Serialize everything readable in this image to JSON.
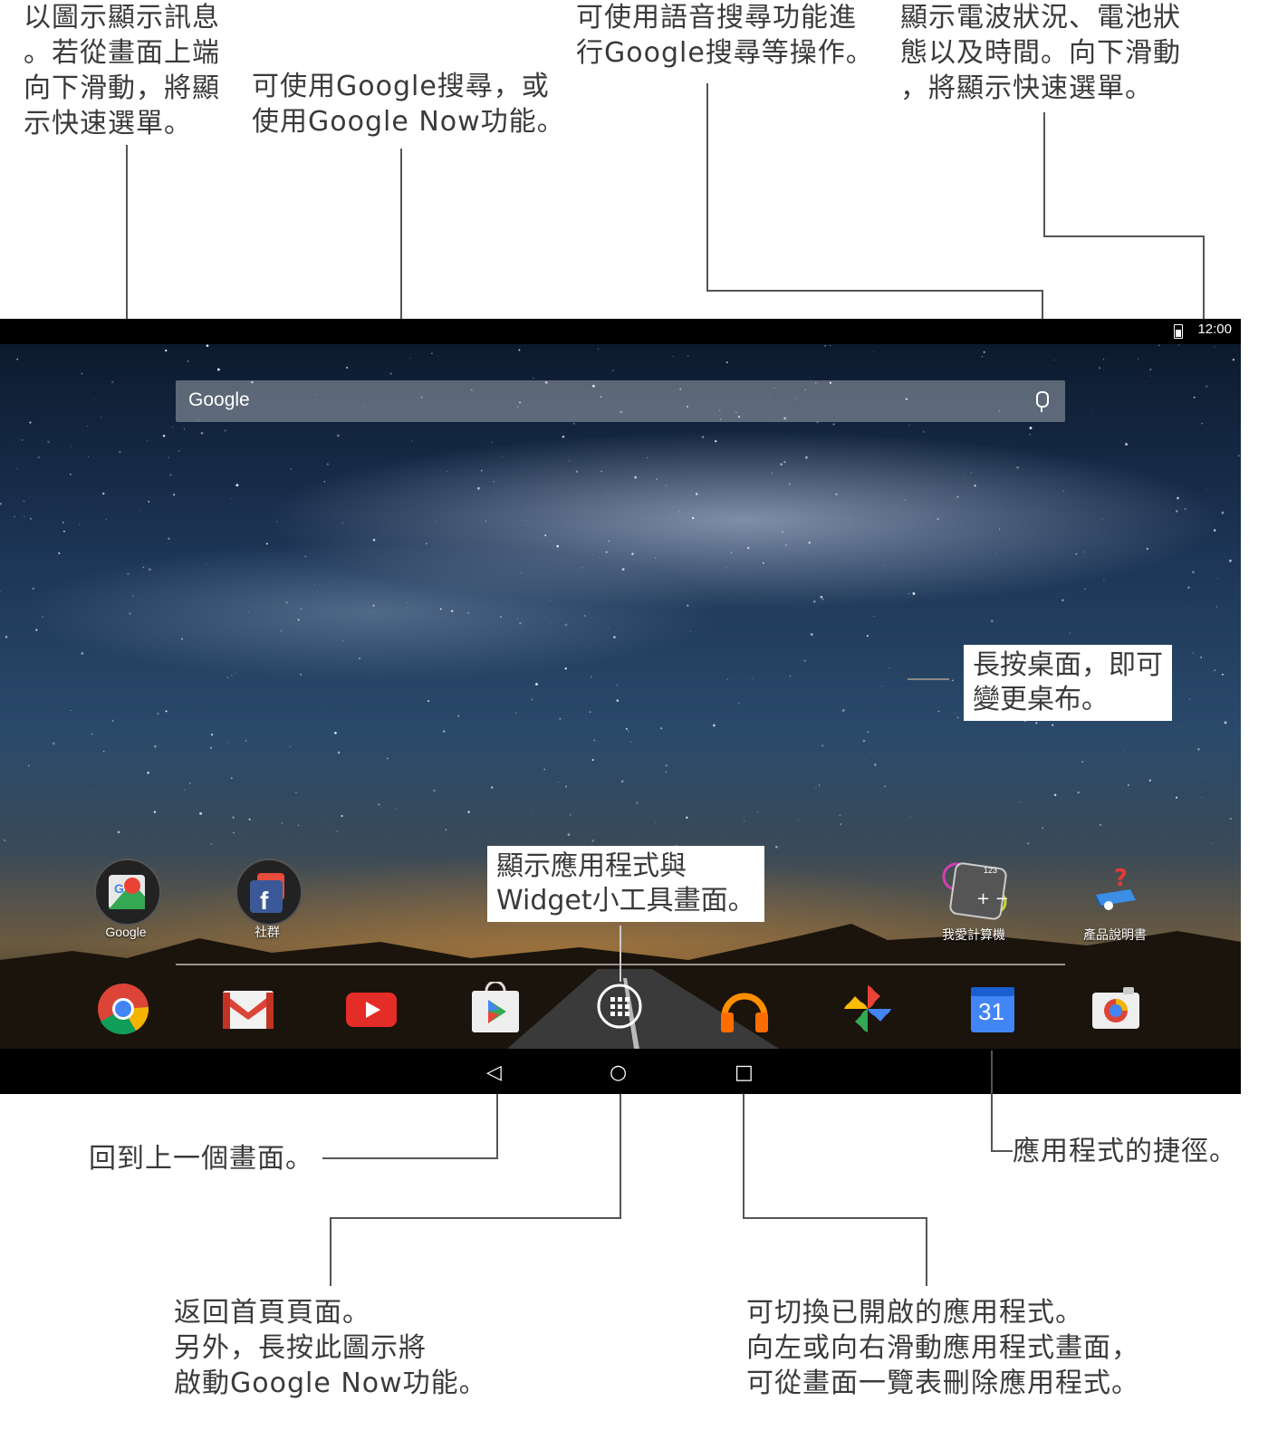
{
  "callouts": {
    "notifications": "以圖示顯示訊息\n。若從畫面上端\n向下滑動，將顯\n示快速選單。",
    "google_search": "可使用Google搜尋，或\n使用Google Now功能。",
    "voice_search": "可使用語音搜尋功能進\n行Google搜尋等操作。",
    "status": "顯示電波狀況、電池狀\n態以及時間。向下滑動\n，將顯示快速選單。",
    "wallpaper": "長按桌面，即可\n變更桌布。",
    "app_drawer": "顯示應用程式與\nWidget小工具畫面。",
    "back": "回到上一個畫面。",
    "shortcuts": "應用程式的捷徑。",
    "home": "返回首頁頁面。\n另外，長按此圖示將\n啟動Google Now功能。",
    "recents": "可切換已開啟的應用程式。\n向左或向右滑動應用程式畫面，\n可從畫面一覽表刪除應用程式。"
  },
  "statusbar": {
    "time": "12:00"
  },
  "search": {
    "logo": "Google"
  },
  "desktop": {
    "google_folder_label": "Google",
    "social_folder_label": "社群",
    "calculator_label": "我愛計算機",
    "manual_label": "產品說明書",
    "calculator_display": "123"
  },
  "dock": {
    "calendar_day": "31"
  },
  "colors": {
    "accent": "#4285f4",
    "chrome_red": "#db4437",
    "chrome_yellow": "#f4b400",
    "chrome_green": "#0f9d58"
  }
}
